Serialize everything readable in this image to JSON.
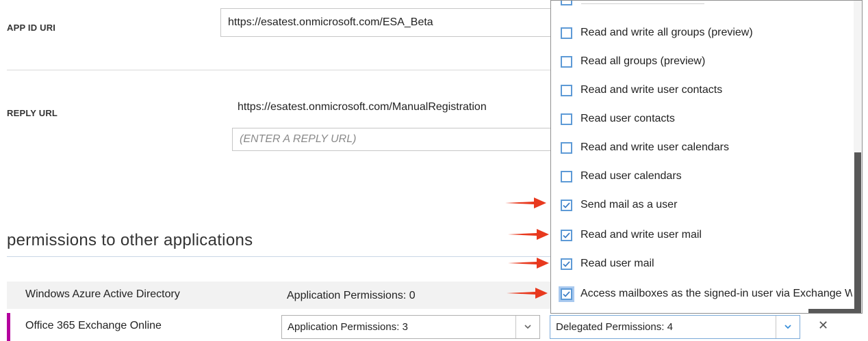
{
  "app_id_uri": {
    "label": "APP ID URI",
    "value": "https://esatest.onmicrosoft.com/ESA_Beta"
  },
  "reply_url": {
    "label": "REPLY URL",
    "value": "https://esatest.onmicrosoft.com/ManualRegistration",
    "placeholder": "(ENTER A REPLY URL)"
  },
  "permissions_section": {
    "title": "permissions to other applications"
  },
  "permission_rows": [
    {
      "app": "Windows Azure Active Directory",
      "application_permissions": "Application Permissions: 0"
    },
    {
      "app": "Office 365 Exchange Online",
      "application_permissions": "Application Permissions: 3",
      "delegated_permissions": "Delegated Permissions: 4"
    }
  ],
  "delegated_dropdown": {
    "items": [
      {
        "label": "Read and write all groups (preview)",
        "checked": false
      },
      {
        "label": "Read all groups (preview)",
        "checked": false
      },
      {
        "label": "Read and write user contacts",
        "checked": false
      },
      {
        "label": "Read user contacts",
        "checked": false
      },
      {
        "label": "Read and write user calendars",
        "checked": false
      },
      {
        "label": "Read user calendars",
        "checked": false
      },
      {
        "label": "Send mail as a user",
        "checked": true
      },
      {
        "label": "Read and write user mail",
        "checked": true
      },
      {
        "label": "Read user mail",
        "checked": true
      },
      {
        "label": "Access mailboxes as the signed-in user via Exchange Web Services",
        "checked": true
      }
    ]
  },
  "colors": {
    "accent": "#b4009e",
    "checkbox": "#5d9ad6",
    "arrow": "#e8391e",
    "scroll_thumb": "#585858"
  },
  "icons": {
    "dropdown": "chevron-down-icon",
    "remove": "close-icon",
    "checkbox": "checkmark-icon",
    "annotation": "red-arrow"
  }
}
